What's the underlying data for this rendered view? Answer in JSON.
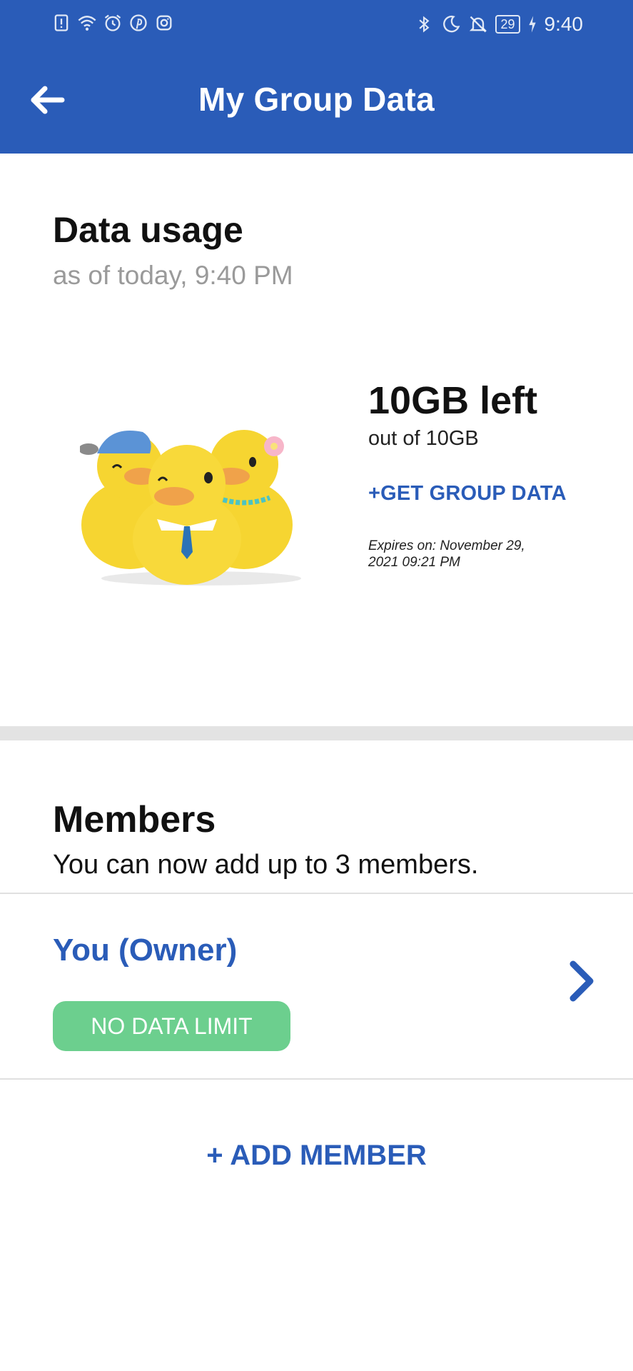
{
  "status_bar": {
    "time": "9:40",
    "battery": "29",
    "left_icons": [
      "sim-alert-icon",
      "wifi-icon",
      "alarm-icon",
      "pinterest-icon",
      "instagram-icon"
    ],
    "right_icons": [
      "bluetooth-icon",
      "moon-icon",
      "bell-off-icon",
      "battery-icon",
      "charging-icon"
    ]
  },
  "header": {
    "title": "My Group Data",
    "back_icon": "arrow-left-icon"
  },
  "usage": {
    "title": "Data usage",
    "subtitle": "as of today, 9:40 PM",
    "data_left": "10GB left",
    "data_total": "out of 10GB",
    "get_data_label": "+GET GROUP DATA",
    "expiry": "Expires on: November 29, 2021 09:21 PM"
  },
  "members": {
    "title": "Members",
    "subtitle": "You can now add up to 3 members.",
    "items": [
      {
        "name": "You (Owner)",
        "badge": "NO DATA LIMIT"
      }
    ],
    "add_label": "+ ADD MEMBER"
  },
  "colors": {
    "primary": "#2a5cb8",
    "badge_green": "#6ccf8e",
    "divider": "#e3e3e3"
  }
}
